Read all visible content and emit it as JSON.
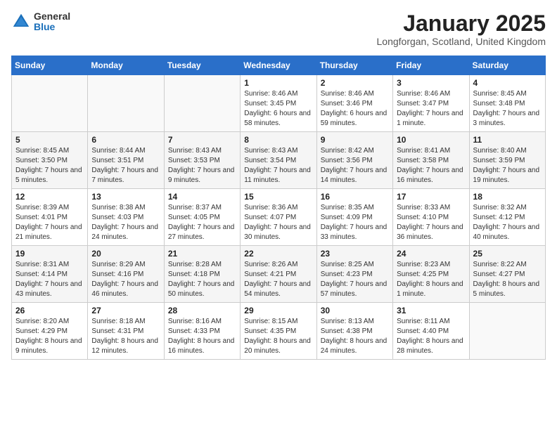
{
  "logo": {
    "general": "General",
    "blue": "Blue"
  },
  "title": "January 2025",
  "location": "Longforgan, Scotland, United Kingdom",
  "days_of_week": [
    "Sunday",
    "Monday",
    "Tuesday",
    "Wednesday",
    "Thursday",
    "Friday",
    "Saturday"
  ],
  "weeks": [
    [
      {
        "day": "",
        "sunrise": "",
        "sunset": "",
        "daylight": ""
      },
      {
        "day": "",
        "sunrise": "",
        "sunset": "",
        "daylight": ""
      },
      {
        "day": "",
        "sunrise": "",
        "sunset": "",
        "daylight": ""
      },
      {
        "day": "1",
        "sunrise": "8:46 AM",
        "sunset": "3:45 PM",
        "daylight": "6 hours and 58 minutes."
      },
      {
        "day": "2",
        "sunrise": "8:46 AM",
        "sunset": "3:46 PM",
        "daylight": "6 hours and 59 minutes."
      },
      {
        "day": "3",
        "sunrise": "8:46 AM",
        "sunset": "3:47 PM",
        "daylight": "7 hours and 1 minute."
      },
      {
        "day": "4",
        "sunrise": "8:45 AM",
        "sunset": "3:48 PM",
        "daylight": "7 hours and 3 minutes."
      }
    ],
    [
      {
        "day": "5",
        "sunrise": "8:45 AM",
        "sunset": "3:50 PM",
        "daylight": "7 hours and 5 minutes."
      },
      {
        "day": "6",
        "sunrise": "8:44 AM",
        "sunset": "3:51 PM",
        "daylight": "7 hours and 7 minutes."
      },
      {
        "day": "7",
        "sunrise": "8:43 AM",
        "sunset": "3:53 PM",
        "daylight": "7 hours and 9 minutes."
      },
      {
        "day": "8",
        "sunrise": "8:43 AM",
        "sunset": "3:54 PM",
        "daylight": "7 hours and 11 minutes."
      },
      {
        "day": "9",
        "sunrise": "8:42 AM",
        "sunset": "3:56 PM",
        "daylight": "7 hours and 14 minutes."
      },
      {
        "day": "10",
        "sunrise": "8:41 AM",
        "sunset": "3:58 PM",
        "daylight": "7 hours and 16 minutes."
      },
      {
        "day": "11",
        "sunrise": "8:40 AM",
        "sunset": "3:59 PM",
        "daylight": "7 hours and 19 minutes."
      }
    ],
    [
      {
        "day": "12",
        "sunrise": "8:39 AM",
        "sunset": "4:01 PM",
        "daylight": "7 hours and 21 minutes."
      },
      {
        "day": "13",
        "sunrise": "8:38 AM",
        "sunset": "4:03 PM",
        "daylight": "7 hours and 24 minutes."
      },
      {
        "day": "14",
        "sunrise": "8:37 AM",
        "sunset": "4:05 PM",
        "daylight": "7 hours and 27 minutes."
      },
      {
        "day": "15",
        "sunrise": "8:36 AM",
        "sunset": "4:07 PM",
        "daylight": "7 hours and 30 minutes."
      },
      {
        "day": "16",
        "sunrise": "8:35 AM",
        "sunset": "4:09 PM",
        "daylight": "7 hours and 33 minutes."
      },
      {
        "day": "17",
        "sunrise": "8:33 AM",
        "sunset": "4:10 PM",
        "daylight": "7 hours and 36 minutes."
      },
      {
        "day": "18",
        "sunrise": "8:32 AM",
        "sunset": "4:12 PM",
        "daylight": "7 hours and 40 minutes."
      }
    ],
    [
      {
        "day": "19",
        "sunrise": "8:31 AM",
        "sunset": "4:14 PM",
        "daylight": "7 hours and 43 minutes."
      },
      {
        "day": "20",
        "sunrise": "8:29 AM",
        "sunset": "4:16 PM",
        "daylight": "7 hours and 46 minutes."
      },
      {
        "day": "21",
        "sunrise": "8:28 AM",
        "sunset": "4:18 PM",
        "daylight": "7 hours and 50 minutes."
      },
      {
        "day": "22",
        "sunrise": "8:26 AM",
        "sunset": "4:21 PM",
        "daylight": "7 hours and 54 minutes."
      },
      {
        "day": "23",
        "sunrise": "8:25 AM",
        "sunset": "4:23 PM",
        "daylight": "7 hours and 57 minutes."
      },
      {
        "day": "24",
        "sunrise": "8:23 AM",
        "sunset": "4:25 PM",
        "daylight": "8 hours and 1 minute."
      },
      {
        "day": "25",
        "sunrise": "8:22 AM",
        "sunset": "4:27 PM",
        "daylight": "8 hours and 5 minutes."
      }
    ],
    [
      {
        "day": "26",
        "sunrise": "8:20 AM",
        "sunset": "4:29 PM",
        "daylight": "8 hours and 9 minutes."
      },
      {
        "day": "27",
        "sunrise": "8:18 AM",
        "sunset": "4:31 PM",
        "daylight": "8 hours and 12 minutes."
      },
      {
        "day": "28",
        "sunrise": "8:16 AM",
        "sunset": "4:33 PM",
        "daylight": "8 hours and 16 minutes."
      },
      {
        "day": "29",
        "sunrise": "8:15 AM",
        "sunset": "4:35 PM",
        "daylight": "8 hours and 20 minutes."
      },
      {
        "day": "30",
        "sunrise": "8:13 AM",
        "sunset": "4:38 PM",
        "daylight": "8 hours and 24 minutes."
      },
      {
        "day": "31",
        "sunrise": "8:11 AM",
        "sunset": "4:40 PM",
        "daylight": "8 hours and 28 minutes."
      },
      {
        "day": "",
        "sunrise": "",
        "sunset": "",
        "daylight": ""
      }
    ]
  ]
}
